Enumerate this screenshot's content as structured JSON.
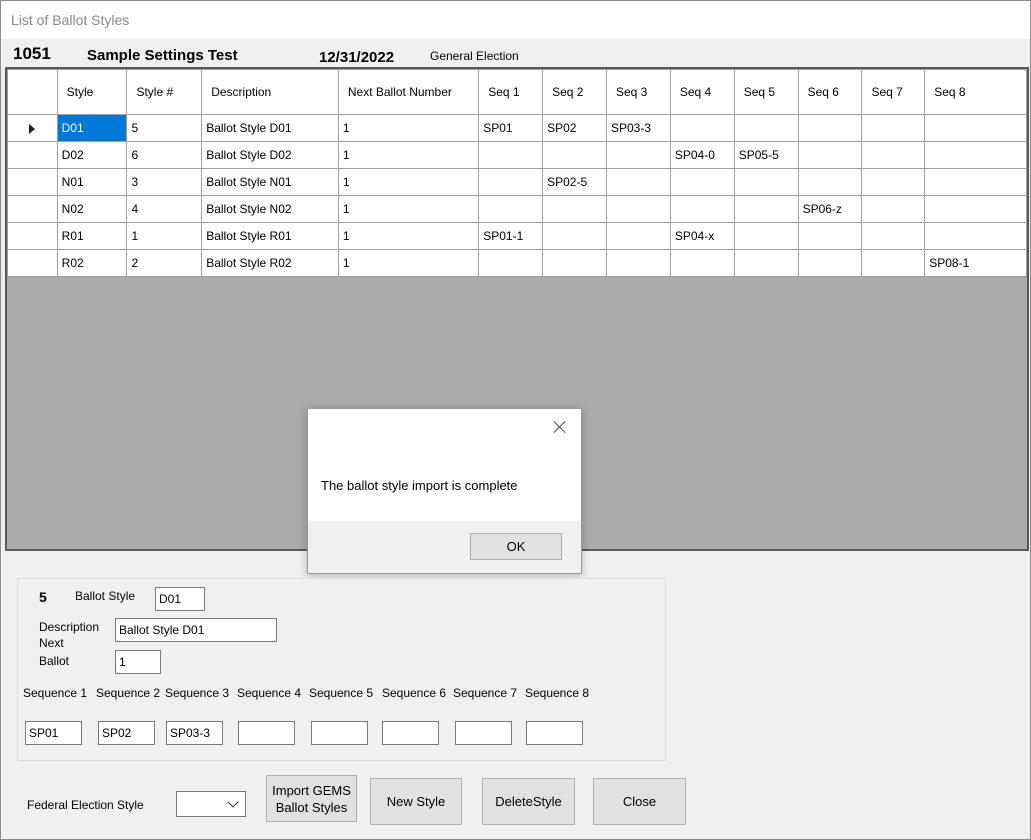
{
  "window": {
    "title": "List of Ballot Styles"
  },
  "header": {
    "number": "1051",
    "name": "Sample Settings Test",
    "date": "12/31/2022",
    "election_type": "General Election"
  },
  "grid": {
    "columns": [
      "Style",
      "Style #",
      "Description",
      "Next Ballot Number",
      "Seq 1",
      "Seq 2",
      "Seq 3",
      "Seq 4",
      "Seq 5",
      "Seq 6",
      "Seq 7",
      "Seq 8"
    ],
    "rows": [
      [
        "D01",
        "5",
        "Ballot Style D01",
        "1",
        "SP01",
        "SP02",
        "SP03-3",
        "",
        "",
        "",
        "",
        ""
      ],
      [
        "D02",
        "6",
        "Ballot Style D02",
        "1",
        "",
        "",
        "",
        "SP04-0",
        "SP05-5",
        "",
        "",
        ""
      ],
      [
        "N01",
        "3",
        "Ballot Style N01",
        "1",
        "",
        "SP02-5",
        "",
        "",
        "",
        "",
        "",
        ""
      ],
      [
        "N02",
        "4",
        "Ballot Style N02",
        "1",
        "",
        "",
        "",
        "",
        "",
        "SP06-z",
        "",
        ""
      ],
      [
        "R01",
        "1",
        "Ballot Style R01",
        "1",
        "SP01-1",
        "",
        "",
        "SP04-x",
        "",
        "",
        "",
        ""
      ],
      [
        "R02",
        "2",
        "Ballot Style R02",
        "1",
        "",
        "",
        "",
        "",
        "",
        "",
        "",
        "SP08-1"
      ]
    ]
  },
  "dialog": {
    "message": "The ballot style import is complete",
    "ok_label": "OK"
  },
  "detail": {
    "style_number": "5",
    "ballot_style_label": "Ballot Style",
    "ballot_style_value": "D01",
    "description_label": "Description",
    "description_value": "Ballot Style D01",
    "next_label": "Next",
    "ballot_label": "Ballot",
    "next_ballot_value": "1",
    "sequences": [
      {
        "label": "Sequence 1",
        "value": "SP01"
      },
      {
        "label": "Sequence 2",
        "value": "SP02"
      },
      {
        "label": "Sequence 3",
        "value": "SP03-3"
      },
      {
        "label": "Sequence 4",
        "value": ""
      },
      {
        "label": "Sequence 5",
        "value": ""
      },
      {
        "label": "Sequence 6",
        "value": ""
      },
      {
        "label": "Sequence 7",
        "value": ""
      },
      {
        "label": "Sequence 8",
        "value": ""
      }
    ]
  },
  "footer": {
    "federal_label": "Federal Election Style",
    "federal_value": "",
    "import_label": "Import GEMS Ballot Styles",
    "new_label": "New Style",
    "delete_label": "DeleteStyle",
    "close_label": "Close"
  },
  "icons": {
    "row_indicator": "triangle-right-icon",
    "dialog_close": "close-icon",
    "dropdown": "chevron-down-icon"
  }
}
